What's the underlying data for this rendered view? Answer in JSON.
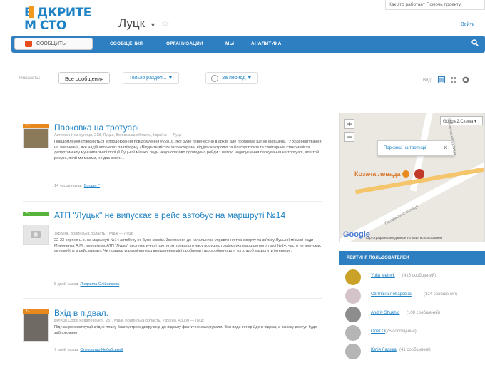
{
  "header": {
    "logo_line1": "В ДКРИТЕ",
    "logo_line2": "М СТО",
    "city": "Луцк",
    "topright_text": "Как это работает    Помочь проекту",
    "login": "Войти"
  },
  "nav": {
    "report_label": "СООБЩИТЬ",
    "items": [
      "СООБЩЕНИЯ",
      "ОРГАНИЗАЦИИ",
      "МЫ",
      "АНАЛИТИКА"
    ]
  },
  "filters": {
    "show_label": "Показать:",
    "all_messages": "Все сообщения",
    "section_select": "Только раздел...",
    "period": "За период",
    "view_label": "Вид:"
  },
  "messages": [
    {
      "badge": "+1",
      "title": "Парковка на тротуарі",
      "address": "Автомагнітна вулиця, 218, Луцьк, Волинська область, Україна — Луцк",
      "body": "Повідомлення створюється в продовження повідомлення #22816, яке було перенесено в архів, але проблема ще не вирішена. \"У ході реагування на звернення, яке надійшло через платформу «Відкрите місто» інспекторами відділу контролю за благоустроєм та санітарним станом міста департаменту муніципальної поліції Луцької міської ради неодноразово проведено рейди з метою недопущення паркування на тротуарі, але той ресурс, який ми маємо, не дає змоги...",
      "meta_time": "14 часов назад",
      "meta_author": "Богдан Г"
    },
    {
      "badge": "+1",
      "title": "АТП \"Луцьк\" не випускає в рейс автобус на маршруті №14",
      "address": "Україна, Волинська область, Луцьк — Луцк",
      "body": "22-23 серпня ц.р. на маршруті №14 автобусу не було зовсім. Звертаюся до начальника управління транспорту та зв'язку Луцької міської ради Мироненка А.М.: перевізник АТП \"Луцьк\" систематично і протягом тривалого часу порушує графік руху маршрутного таксі №14, часто не випускає автомобіль в рейс взагалі. Чи працює управління над вирішенням цієї проблеми і що зроблено для того, щоб захистити інтереси...",
      "meta_time": "5 дней назад",
      "meta_author": "Людмила Олійникова"
    },
    {
      "badge": "+1",
      "title": "Вхід в підвал.",
      "address": "вулиця Софії Ковалевської, 25, Луцьк, Волинська область, Україна, 43000 — Луцк",
      "body": "Під час реконструкції згідно плану благоустрою двору вхід до підвалу фактично замурували. Вся вода тепер йде в підвал, а взимку доступ буде заблоковано.",
      "meta_time": "7 дней назад",
      "meta_author": "Олександр Небабський"
    }
  ],
  "map": {
    "type_label": "Google2.Схема",
    "popup": "Парковка на тротуарі",
    "place": "Козача левада",
    "street1": "Рівненська вулиця",
    "street2": "Гордіївська вулиця",
    "google": "Google",
    "attribution": "Картографические данные    Условия использования"
  },
  "rating": {
    "title": "РЕЙТИНГ ПОЛЬЗОВАТЕЛЕЙ",
    "users": [
      {
        "name": "Yulia Melnyk",
        "count": "(415 сообщений)"
      },
      {
        "name": "Світлана Лобарєвна",
        "count": "(124 сообщения)"
      },
      {
        "name": "Andriy Shukhlo",
        "count": "(108 сообщений)"
      },
      {
        "name": "Олег О",
        "count": "(75 сообщений)"
      },
      {
        "name": "Юлія Ладика",
        "count": "(41 сообщение)"
      }
    ]
  },
  "colors": {
    "brand_blue": "#2d7fc1",
    "accent_orange": "#e8891e",
    "accent_green": "#56b33a"
  }
}
